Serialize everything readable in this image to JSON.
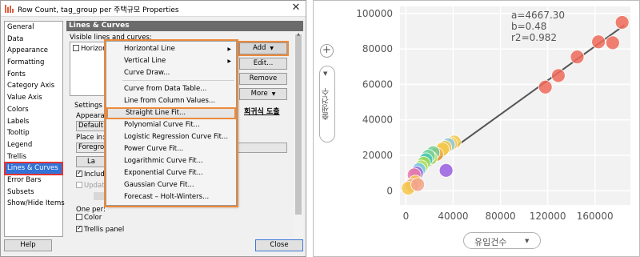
{
  "window": {
    "title": "Row Count, tag_group per 주택규모 Properties",
    "close_glyph": "✕"
  },
  "nav": {
    "items": [
      "General",
      "Data",
      "Appearance",
      "Formatting",
      "Fonts",
      "Category Axis",
      "Value Axis",
      "Colors",
      "Labels",
      "Tooltip",
      "Legend",
      "Trellis",
      "Lines & Curves",
      "Error Bars",
      "Subsets",
      "Show/Hide Items"
    ],
    "selected": "Lines & Curves"
  },
  "panel": {
    "heading": "Lines & Curves",
    "visible_label": "Visible lines and curves:",
    "list_item": "Horizon",
    "buttons": {
      "add": "Add",
      "edit": "Edit...",
      "remove": "Remove",
      "more": "More"
    },
    "settings_label": "Settings",
    "appearance_label": "Appearan",
    "appearance_value": "Default",
    "place_label": "Place in:",
    "place_value": "Foregrou",
    "label_button": "La",
    "include_label": "Includ",
    "update_label": "Updat",
    "one_per_label": "One per:",
    "color_label": "Color",
    "trellis_label": "Trellis panel"
  },
  "menu": {
    "items": [
      {
        "label": "Horizontal Line",
        "submenu": true
      },
      {
        "label": "Vertical Line",
        "submenu": true
      },
      {
        "label": "Curve Draw..."
      },
      {
        "label": "Curve from Data Table..."
      },
      {
        "label": "Line from Column Values..."
      },
      {
        "label": "Straight Line Fit...",
        "highlighted": true
      },
      {
        "label": "Polynomial Curve Fit..."
      },
      {
        "label": "Logistic Regression Curve Fit..."
      },
      {
        "label": "Power Curve Fit..."
      },
      {
        "label": "Logarithmic Curve Fit..."
      },
      {
        "label": "Exponential Curve Fit..."
      },
      {
        "label": "Gaussian Curve Fit..."
      },
      {
        "label": "Forecast – Holt-Winters..."
      }
    ]
  },
  "annotation": "회귀식 도출",
  "footer": {
    "help": "Help",
    "close": "Close"
  },
  "chart": {
    "ylabel": "출생건수",
    "xlabel": "유입건수",
    "stats": [
      "a=4667.30",
      "b=0.48",
      "r2=0.982"
    ]
  },
  "chart_data": {
    "type": "scatter",
    "xlabel": "유입건수",
    "ylabel": "출생건수",
    "xlim": [
      -5000,
      190000
    ],
    "ylim": [
      -8000,
      104000
    ],
    "x_ticks": [
      0,
      40000,
      80000,
      120000,
      160000
    ],
    "y_ticks": [
      0,
      20000,
      40000,
      60000,
      80000,
      100000
    ],
    "fit": {
      "a": 4667.3,
      "b": 0.48,
      "r2": 0.982,
      "x_range": [
        0,
        185000
      ]
    },
    "points": [
      {
        "x": 183000,
        "y": 95000,
        "color": "#ef6a5a"
      },
      {
        "x": 163000,
        "y": 84000,
        "color": "#ef6a5a"
      },
      {
        "x": 175000,
        "y": 83500,
        "color": "#ef6a5a"
      },
      {
        "x": 145000,
        "y": 75500,
        "color": "#ef6a5a"
      },
      {
        "x": 129000,
        "y": 65000,
        "color": "#ef6a5a"
      },
      {
        "x": 118000,
        "y": 58500,
        "color": "#ef6a5a"
      },
      {
        "x": 41000,
        "y": 27500,
        "color": "#f4c84a"
      },
      {
        "x": 38000,
        "y": 26500,
        "color": "#f4c84a"
      },
      {
        "x": 36000,
        "y": 26000,
        "color": "#8dc9e8"
      },
      {
        "x": 33000,
        "y": 24500,
        "color": "#f4c84a"
      },
      {
        "x": 31000,
        "y": 23500,
        "color": "#f4c84a"
      },
      {
        "x": 26000,
        "y": 20500,
        "color": "#f1a340"
      },
      {
        "x": 23000,
        "y": 21500,
        "color": "#6fcf97"
      },
      {
        "x": 21000,
        "y": 18500,
        "color": "#b6e36a"
      },
      {
        "x": 19000,
        "y": 19500,
        "color": "#6fcf97"
      },
      {
        "x": 17000,
        "y": 17500,
        "color": "#4ec8b2"
      },
      {
        "x": 15000,
        "y": 15500,
        "color": "#a7d94f"
      },
      {
        "x": 13000,
        "y": 13500,
        "color": "#b6e36a"
      },
      {
        "x": 11000,
        "y": 12000,
        "color": "#78c5ef"
      },
      {
        "x": 9000,
        "y": 10000,
        "color": "#9a6ad8"
      },
      {
        "x": 7000,
        "y": 9000,
        "color": "#ec7aa8"
      },
      {
        "x": 8000,
        "y": 5000,
        "color": "#f4c84a"
      },
      {
        "x": 5000,
        "y": 3000,
        "color": "#f2a38a"
      },
      {
        "x": 2000,
        "y": 1500,
        "color": "#f4c84a"
      },
      {
        "x": 10000,
        "y": 3500,
        "color": "#f2a38a"
      },
      {
        "x": 34000,
        "y": 11500,
        "color": "#9a5ee0"
      }
    ]
  }
}
